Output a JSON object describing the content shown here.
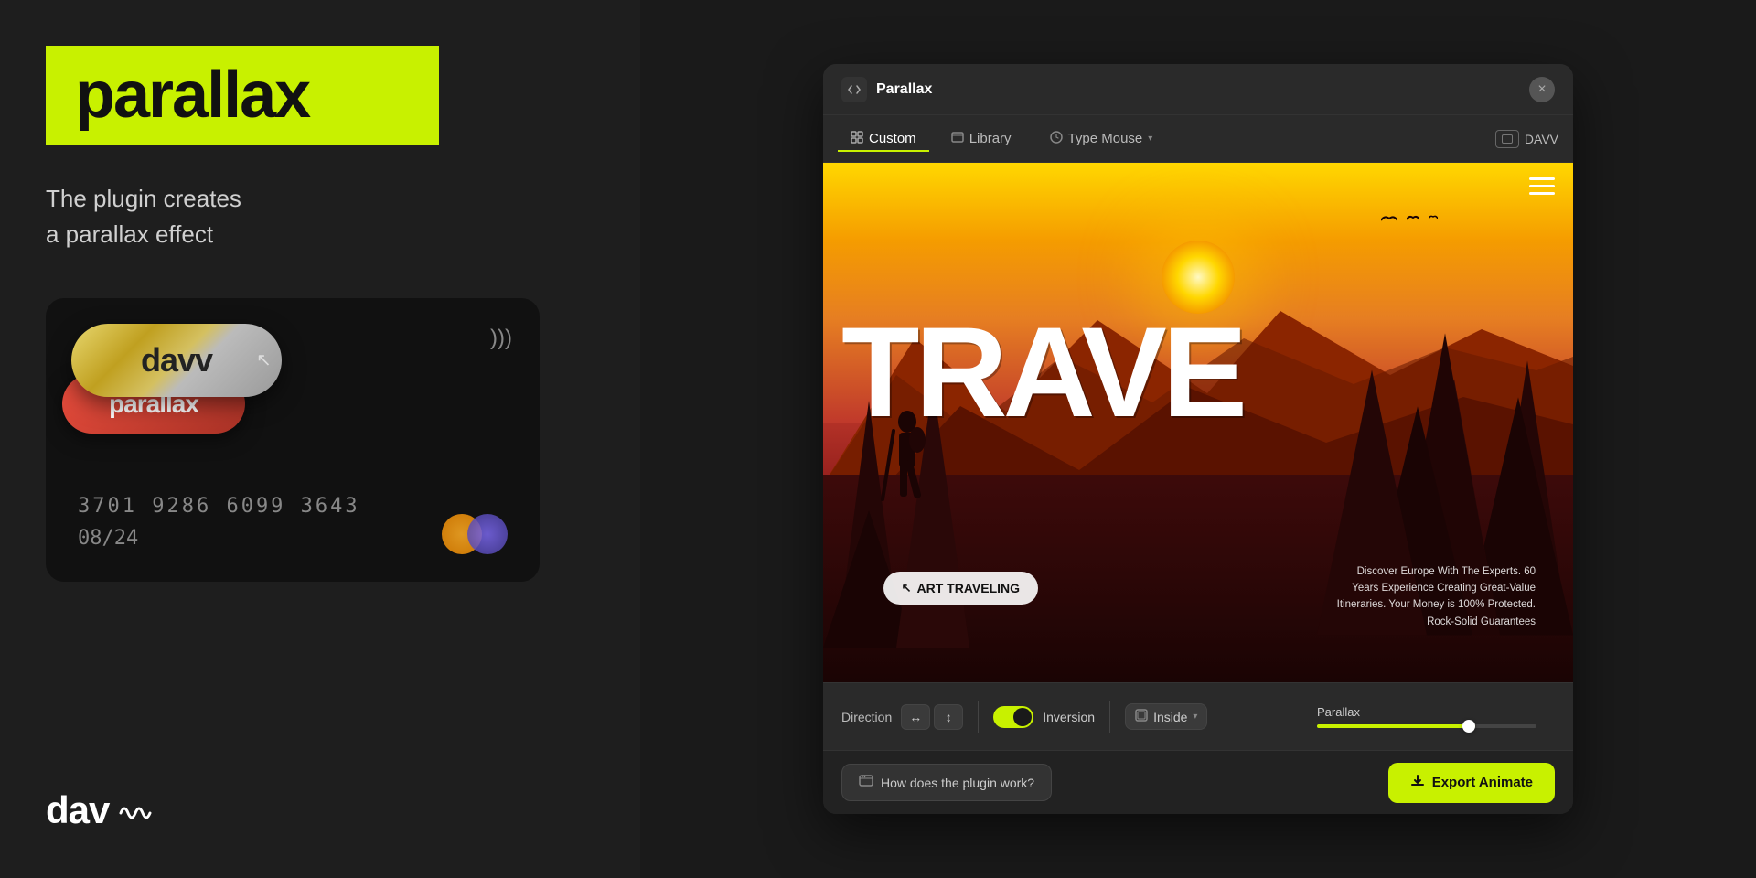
{
  "left": {
    "logo": "parallax",
    "tagline_line1": "The plugin creates",
    "tagline_line2": "a parallax effect",
    "card": {
      "brand_top": "davv",
      "brand_bottom": "parallax",
      "number": "3701  9286  6099  3643",
      "expiry": "08/24"
    },
    "bottom_logo": "dav~"
  },
  "plugin": {
    "title": "Parallax",
    "title_icon": "</>",
    "close_label": "×",
    "tabs": [
      {
        "id": "custom",
        "label": "Custom",
        "active": true
      },
      {
        "id": "library",
        "label": "Library",
        "active": false
      }
    ],
    "type_tab": "Type Mouse",
    "user_label": "DAVV",
    "preview": {
      "travel_text": "TRAVE",
      "start_btn": "ART TRAVELING",
      "description": "Discover Europe With The Experts. 60 Years Experience Creating Great-Value Itineraries. Your Money is 100% Protected. Rock-Solid Guarantees"
    },
    "controls": {
      "direction_label": "Direction",
      "dir_h": "↔",
      "dir_v": "↕",
      "inversion_label": "Inversion",
      "inside_label": "Inside",
      "parallax_label": "Parallax",
      "slider_value": 72
    },
    "bottom": {
      "help_btn": "How does the plugin work?",
      "export_btn": "Export Animate"
    }
  }
}
